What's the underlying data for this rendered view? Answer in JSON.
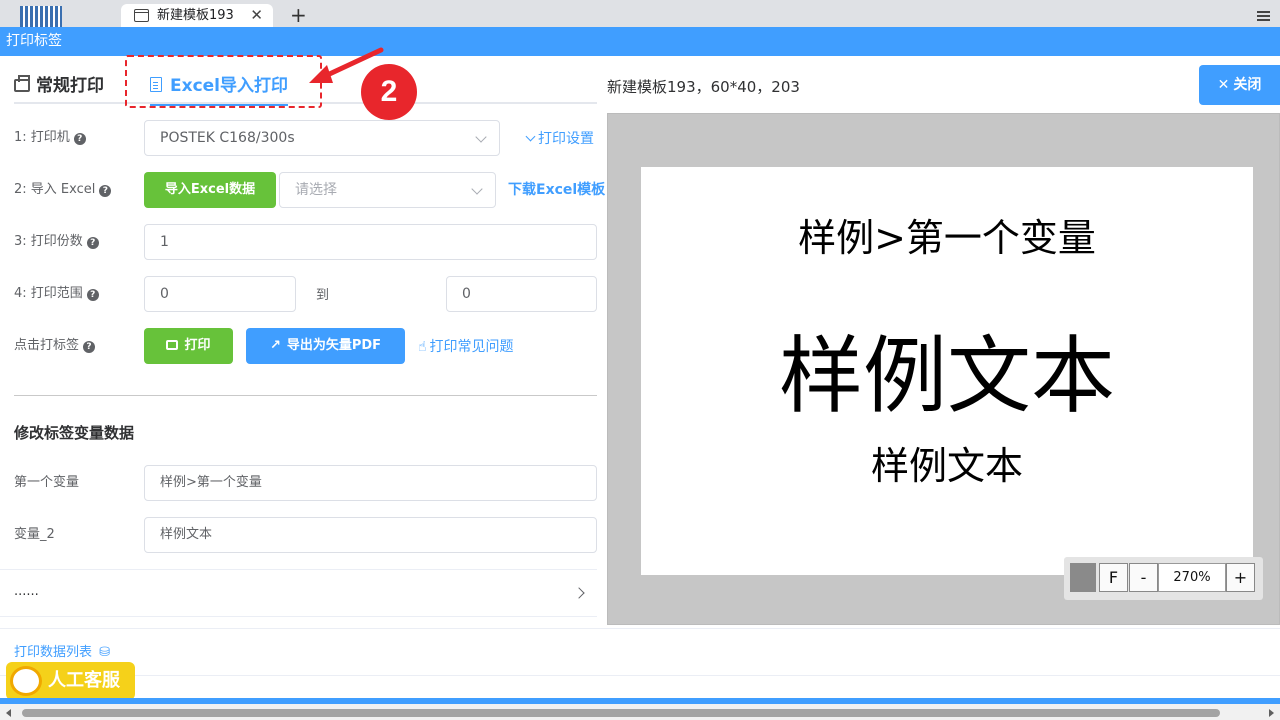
{
  "browser": {
    "tab_title": "新建模板193",
    "close_glyph": "✕",
    "new_tab_glyph": "+"
  },
  "dialog": {
    "title": "打印标签"
  },
  "mode_tabs": {
    "normal": "常规打印",
    "excel": "Excel导入打印"
  },
  "annotation": {
    "step": "2",
    "color": "#e8262c"
  },
  "form": {
    "printer": {
      "label": "1: 打印机",
      "value": "POSTEK C168/300s",
      "link": "打印设置"
    },
    "import": {
      "label": "2: 导入 Excel",
      "button": "导入Excel数据",
      "placeholder": "请选择",
      "link": "下载Excel模板"
    },
    "copies": {
      "label": "3: 打印份数",
      "value": "1"
    },
    "range": {
      "label": "4: 打印范围",
      "from": "0",
      "to_label": "到",
      "to": "0"
    },
    "action": {
      "label": "点击打标签",
      "print_button": "打印",
      "pdf_button": "导出为矢量PDF",
      "faq_link": "打印常见问题"
    },
    "help_glyph": "?"
  },
  "variables": {
    "title": "修改标签变量数据",
    "items": [
      {
        "label": "第一个变量",
        "value": "样例>第一个变量"
      },
      {
        "label": "变量_2",
        "value": "样例文本"
      }
    ],
    "more": "......"
  },
  "data_list_link": "打印数据列表",
  "preview": {
    "template_info": "新建模板193，60*40，203",
    "close_button": "关闭",
    "close_glyph": "✕",
    "label_lines": [
      "样例>第一个变量",
      "样例文本",
      "样例文本"
    ],
    "zoom": {
      "fit": "F",
      "minus": "-",
      "value": "270%",
      "plus": "+"
    }
  },
  "service_badge": "人工客服",
  "colors": {
    "primary": "#409eff",
    "success": "#67c23a",
    "badge": "#f5d11a"
  }
}
